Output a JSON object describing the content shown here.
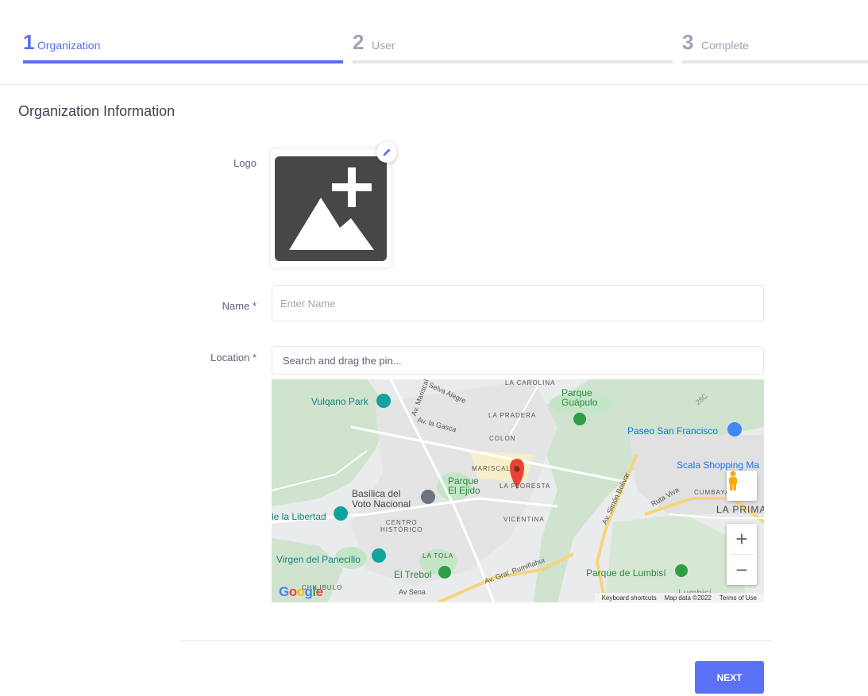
{
  "stepper": {
    "steps": [
      {
        "number": "1",
        "label": "Organization",
        "state": "active"
      },
      {
        "number": "2",
        "label": "User",
        "state": "inactive"
      },
      {
        "number": "3",
        "label": "Complete",
        "state": "inactive"
      }
    ]
  },
  "section_title": "Organization Information",
  "logo": {
    "label": "Logo",
    "edit_icon": "pencil-icon",
    "placeholder_icon": "add-image-icon"
  },
  "name_field": {
    "label": "Name *",
    "value": "",
    "placeholder": "Enter Name"
  },
  "location_field": {
    "label": "Location *",
    "value": "",
    "placeholder": "Search and drag the pin..."
  },
  "map": {
    "labels": {
      "la_carolina": "LA CAROLINA",
      "parque_guapulo": "Parque\nGuápulo",
      "vulqano_park": "Vulqano Park",
      "selva_alegre": "Selva Alegre",
      "av_mariscal": "Av. Mariscal S",
      "av_la_gasca": "Av. la Gasca",
      "la_pradera": "LA PRADERA",
      "paseo_san_francisco": "Paseo San Francisco",
      "colon": "COLON",
      "scala_shopping": "Scala Shopping Ma",
      "mariscal_s": "MARISCAL S",
      "parque_el_ejido": "Parque\nEl Ejido",
      "la_floresta": "LA FLORESTA",
      "basilica": "Basílica del\nVoto Nacional",
      "cumbaya": "CUMBAYA",
      "la_primavera": "LA PRIMA",
      "ruta_viva": "Ruta Viva",
      "av_simon_bolivar": "Av. Simón Bolívar",
      "la_libertad": "le la Libertad",
      "centro_historico": "CENTRO\nHISTÓRICO",
      "vicentina": "VICENTINA",
      "virgen_panecillo": "Virgen del Panecillo",
      "la_tola": "LA TOLA",
      "el_trebol": "El Trebol",
      "av_gral_rumiñahui": "Av. Gral. Rumiñahui",
      "parque_lumbisi": "Parque de Lumbisí",
      "chilibulo": "CHILIBULO",
      "av_sena": "Av Sena",
      "lumbisi": "Lumbisí",
      "road_28c": "28C"
    },
    "google_logo": "Google",
    "attribution": {
      "keyboard": "Keyboard shortcuts",
      "map_data": "Map data ©2022",
      "terms": "Terms of Use"
    },
    "colors": {
      "pin": "#ea4335",
      "park": "#c3e6c7",
      "road": "#ffffff",
      "highway": "#f6d57a"
    }
  },
  "next_button": "NEXT",
  "colors": {
    "accent": "#5b6cf9",
    "button": "#5b72f7",
    "inactive": "#9fa3b3"
  }
}
